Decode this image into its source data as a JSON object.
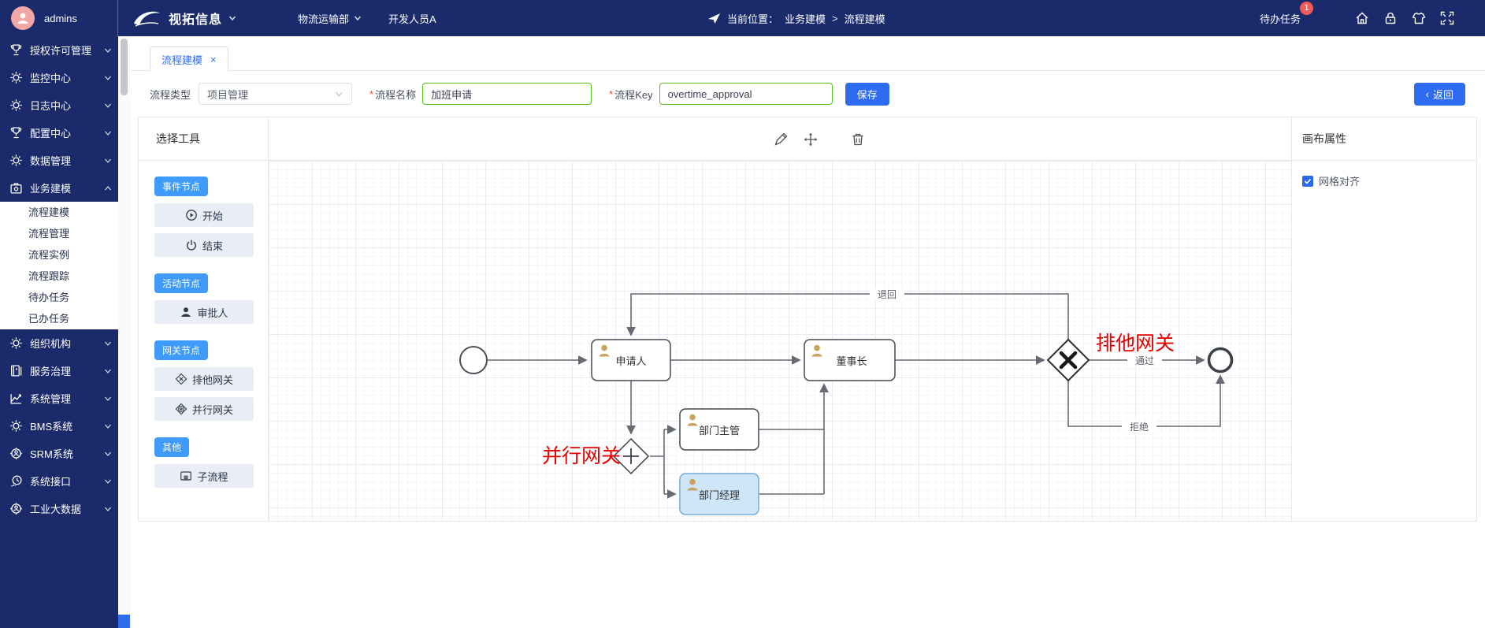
{
  "topbar": {
    "username": "admins",
    "brand": "视拓信息",
    "department": "物流运输部",
    "role": "开发人员A",
    "location_label": "当前位置：",
    "breadcrumb": {
      "parent": "业务建模",
      "sep": ">",
      "current": "流程建模"
    },
    "todo_label": "待办任务",
    "todo_count": "1"
  },
  "sidebar": {
    "items_top": [
      {
        "label": "授权许可管理"
      },
      {
        "label": "监控中心"
      },
      {
        "label": "日志中心"
      },
      {
        "label": "配置中心"
      },
      {
        "label": "数据管理"
      }
    ],
    "group_business": {
      "label": "业务建模"
    },
    "submenu": [
      {
        "label": "流程建模"
      },
      {
        "label": "流程管理"
      },
      {
        "label": "流程实例"
      },
      {
        "label": "流程跟踪"
      },
      {
        "label": "待办任务"
      },
      {
        "label": "已办任务"
      }
    ],
    "items_bottom": [
      {
        "label": "组织机构"
      },
      {
        "label": "服务治理"
      },
      {
        "label": "系统管理"
      },
      {
        "label": "BMS系统"
      },
      {
        "label": "SRM系统"
      },
      {
        "label": "系统接口"
      },
      {
        "label": "工业大数据"
      }
    ]
  },
  "tab": {
    "label": "流程建模",
    "close": "×"
  },
  "form": {
    "type_label": "流程类型",
    "type_value": "项目管理",
    "name_label": "流程名称",
    "name_value": "加班申请",
    "key_label": "流程Key",
    "key_value": "overtime_approval",
    "save_label": "保存",
    "back_label": "返回",
    "back_arrow": "‹"
  },
  "palette": {
    "title": "选择工具",
    "sections": [
      {
        "tag": "事件节点",
        "items": [
          {
            "label": "开始"
          },
          {
            "label": "结束"
          }
        ]
      },
      {
        "tag": "活动节点",
        "items": [
          {
            "label": "审批人"
          }
        ]
      },
      {
        "tag": "网关节点",
        "items": [
          {
            "label": "排他网关"
          },
          {
            "label": "并行网关"
          }
        ]
      },
      {
        "tag": "其他",
        "items": [
          {
            "label": "子流程"
          }
        ]
      }
    ]
  },
  "props_panel": {
    "title": "画布属性",
    "grid_snap_label": "网格对齐",
    "grid_snap_checked": true
  },
  "diagram": {
    "node_applicant": "申请人",
    "node_chairman": "董事长",
    "node_dept_head": "部门主管",
    "node_dept_manager": "部门经理",
    "edge_return": "退回",
    "edge_pass": "通过",
    "edge_reject": "拒绝",
    "annotation_exclusive": "排他网关",
    "annotation_parallel": "并行网关"
  },
  "colors": {
    "primary_blue": "#2f6bf0",
    "pill_blue": "#3f9bfa",
    "navy_bg": "#1a2a6b",
    "input_green": "#52c41a",
    "annotation_red": "#e60000",
    "badge_red": "#f25a5a",
    "selected_node_fill": "#cfe5f8",
    "person_icon_tan": "#c8a35f"
  }
}
